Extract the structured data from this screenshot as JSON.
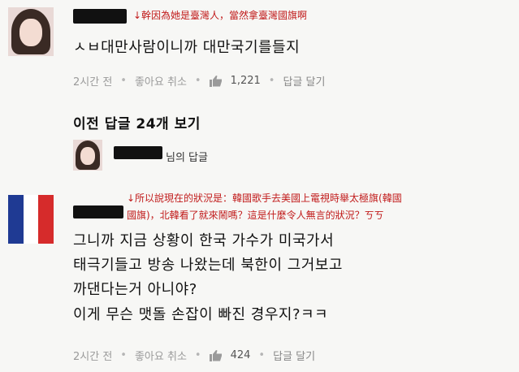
{
  "comments": [
    {
      "annotation": "↓幹因為她是臺灣人，當然拿臺灣國旗啊",
      "text": "ㅅㅂ대만사람이니까 대만국기를들지",
      "time": "2시간 전",
      "like_label": "좋아요 취소",
      "like_count": "1,221",
      "reply_label": "답글 달기"
    },
    {
      "annotation_lines": [
        "↓所以說現在的狀況是：韓國歌手去美國上電視時舉太極旗(韓國",
        "國旗)，北韓看了就來鬧嗎？這是什麼令人無言的狀況？ㄎㄎ"
      ],
      "text_lines": [
        "그니까 지금 상황이 한국 가수가 미국가서",
        "태극기들고 방송 나왔는데 북한이 그거보고",
        "까댄다는거 아니야?",
        "이게 무슨 맷돌 손잡이 빠진 경우지?ㅋㅋ"
      ],
      "time": "2시간 전",
      "like_label": "좋아요 취소",
      "like_count": "424",
      "reply_label": "답글 달기"
    }
  ],
  "view_replies": "이전 답글 24개 보기",
  "reply_author_suffix": "님의 답글",
  "colors": {
    "annotation": "#c11b1b",
    "meta": "#9a9a9a",
    "background": "#f7f7f5"
  },
  "icons": [
    "thumbs-up-icon"
  ]
}
